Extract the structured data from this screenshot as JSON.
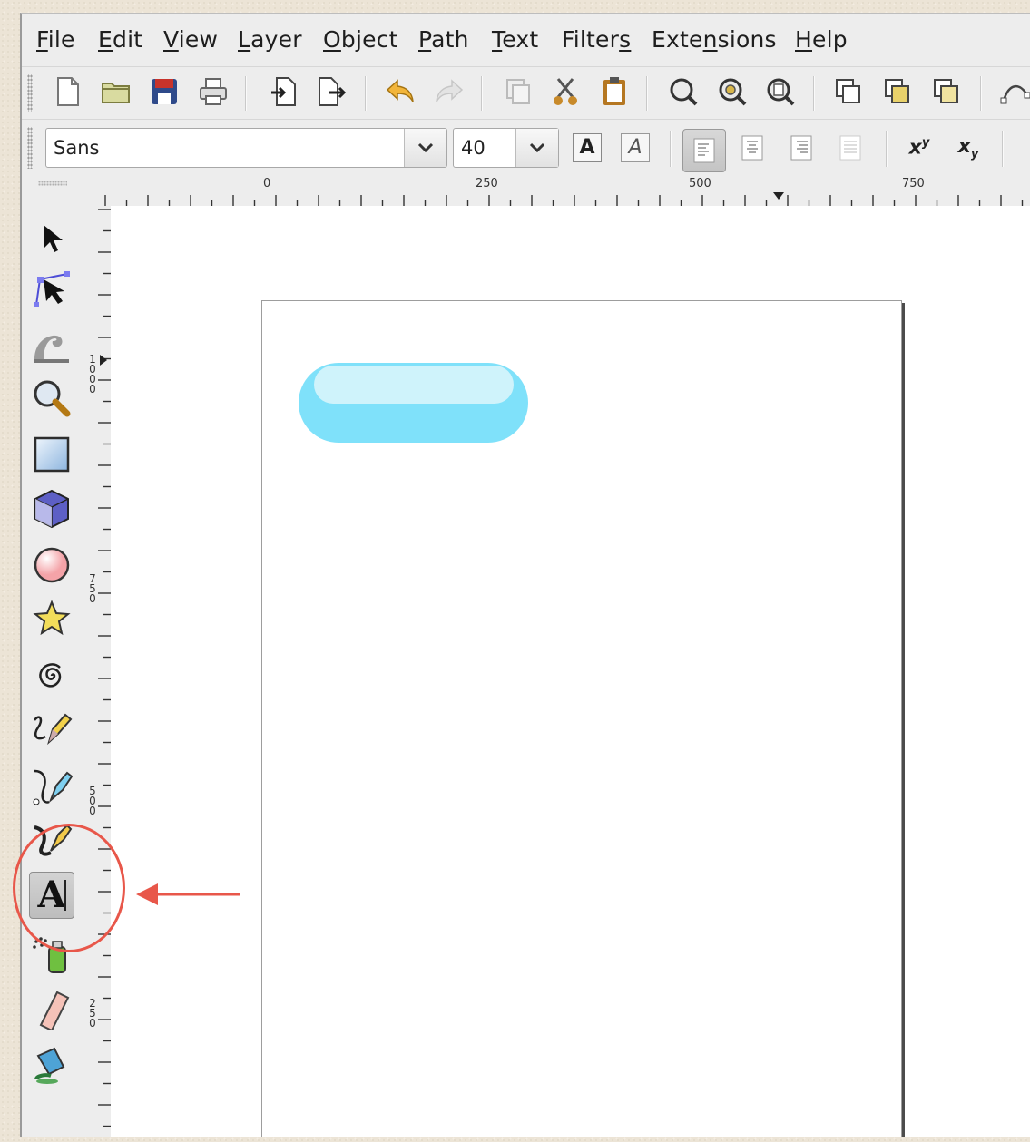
{
  "menubar": {
    "items": [
      {
        "pre": "",
        "u": "F",
        "post": "ile"
      },
      {
        "pre": "",
        "u": "E",
        "post": "dit"
      },
      {
        "pre": "",
        "u": "V",
        "post": "iew"
      },
      {
        "pre": "",
        "u": "L",
        "post": "ayer"
      },
      {
        "pre": "",
        "u": "O",
        "post": "bject"
      },
      {
        "pre": "",
        "u": "P",
        "post": "ath"
      },
      {
        "pre": "",
        "u": "T",
        "post": "ext"
      },
      {
        "pre": "Filter",
        "u": "s",
        "post": ""
      },
      {
        "pre": "Exte",
        "u": "n",
        "post": "sions"
      },
      {
        "pre": "",
        "u": "H",
        "post": "elp"
      }
    ]
  },
  "command_bar": {
    "icons": [
      "new-document-icon",
      "open-folder-icon",
      "save-icon",
      "print-icon",
      "import-icon",
      "export-icon",
      "undo-icon",
      "redo-icon",
      "duplicate-icon",
      "cut-icon",
      "paste-icon",
      "zoom-selection-icon",
      "zoom-drawing-icon",
      "zoom-page-icon",
      "paste-in-place-icon",
      "group-icon",
      "ungroup-icon",
      "node-editor-icon"
    ]
  },
  "text_toolbar": {
    "font_family": "Sans",
    "font_size": "40",
    "bold_label": "A",
    "italic_label": "A",
    "superscript_base": "x",
    "superscript_mark": "y",
    "subscript_base": "x",
    "subscript_mark": "y"
  },
  "ruler": {
    "h_labels": [
      "0",
      "250",
      "500",
      "750"
    ],
    "v_labels": [
      "1000",
      "750",
      "500",
      "250"
    ]
  },
  "toolbox": {
    "tools": [
      "selector-tool",
      "node-tool",
      "tweak-tool",
      "zoom-tool",
      "rectangle-tool",
      "3d-box-tool",
      "ellipse-tool",
      "star-tool",
      "spiral-tool",
      "pencil-tool",
      "pen-tool",
      "calligraphy-tool",
      "text-tool",
      "spray-tool",
      "eraser-tool",
      "paint-bucket-tool"
    ],
    "active_tool": "text-tool",
    "text_tool_glyph": "A"
  },
  "colors": {
    "pill_fill": "#7fe1fa",
    "pill_highlight": "#cff3fb",
    "annotation": "#e8574a"
  }
}
